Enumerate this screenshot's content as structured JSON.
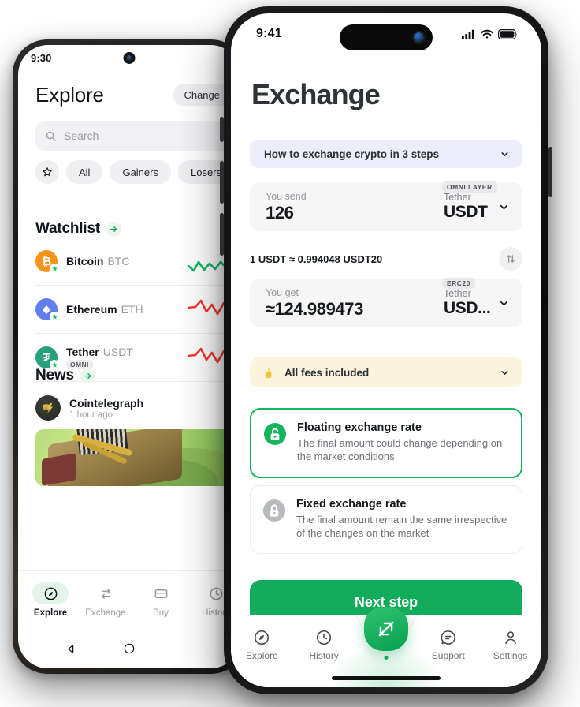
{
  "back_phone": {
    "platform": "android",
    "status": {
      "time": "9:30"
    },
    "header": {
      "title": "Explore",
      "change_label": "Change"
    },
    "search": {
      "placeholder": "Search",
      "icon": "search-icon"
    },
    "filters": [
      {
        "label": "",
        "icon": "star-icon"
      },
      {
        "label": "All"
      },
      {
        "label": "Gainers"
      },
      {
        "label": "Losers"
      }
    ],
    "watchlist": {
      "title": "Watchlist",
      "coins": [
        {
          "name": "Bitcoin",
          "ticker": "BTC",
          "symbol": "₿",
          "color": "#f7931a",
          "tag": "",
          "trend": "up"
        },
        {
          "name": "Ethereum",
          "ticker": "ETH",
          "symbol": "◆",
          "color": "#627eea",
          "tag": "",
          "trend": "down"
        },
        {
          "name": "Tether",
          "ticker": "USDT",
          "symbol": "₮",
          "color": "#26a17b",
          "tag": "OMNI",
          "trend": "down"
        }
      ]
    },
    "news": {
      "title": "News",
      "source": "Cointelegraph",
      "time": "1 hour ago"
    },
    "tabbar": [
      {
        "label": "Explore",
        "icon": "compass-icon",
        "active": true
      },
      {
        "label": "Exchange",
        "icon": "swap-icon",
        "active": false
      },
      {
        "label": "Buy",
        "icon": "card-icon",
        "active": false
      },
      {
        "label": "History",
        "icon": "clock-icon",
        "active": false
      }
    ],
    "navbar": [
      {
        "icon": "back-triangle-icon"
      },
      {
        "icon": "home-circle-icon"
      }
    ]
  },
  "front_phone": {
    "platform": "ios",
    "status": {
      "time": "9:41",
      "icons": [
        "cellular-icon",
        "wifi-icon",
        "battery-icon"
      ]
    },
    "page_title": "Exchange",
    "howto": {
      "label": "How to exchange crypto in 3 steps",
      "icon": "chevron-down-icon"
    },
    "send": {
      "label": "You send",
      "value": "126",
      "coin_name": "Tether",
      "coin_ticker": "USDT",
      "network": "OMNI LAYER"
    },
    "rate": {
      "text": "1 USDT ≈ 0.994048 USDT20",
      "swap_icon": "swap-vertical-icon"
    },
    "get": {
      "label": "You get",
      "value": "≈124.989473",
      "coin_name": "Tether",
      "coin_ticker": "USD...",
      "network": "ERC20"
    },
    "fees": {
      "label": "All fees included",
      "emoji": "☝️",
      "icon": "chevron-down-icon"
    },
    "rate_options": [
      {
        "title": "Floating exchange rate",
        "desc": "The final amount could change depending on the market conditions",
        "icon": "unlock-icon",
        "selected": true
      },
      {
        "title": "Fixed exchange rate",
        "desc": "The final amount remain the same irrespective of the changes on the market",
        "icon": "lock-icon",
        "selected": false
      }
    ],
    "next_button": "Next step",
    "tabbar": [
      {
        "label": "Explore",
        "icon": "compass-icon",
        "active": false
      },
      {
        "label": "History",
        "icon": "clock-icon",
        "active": false
      },
      {
        "label": "",
        "icon": "exchange-arrows-icon",
        "active": true
      },
      {
        "label": "Support",
        "icon": "chat-icon",
        "active": false
      },
      {
        "label": "Settings",
        "icon": "person-icon",
        "active": false
      }
    ]
  },
  "colors": {
    "brand_green": "#13ab5c",
    "accent_purple": "#eeedfb",
    "accent_yellow": "#fdf4de",
    "card_grey": "#f6f6f7",
    "up_green": "#14b45c",
    "down_red": "#f3392f"
  }
}
